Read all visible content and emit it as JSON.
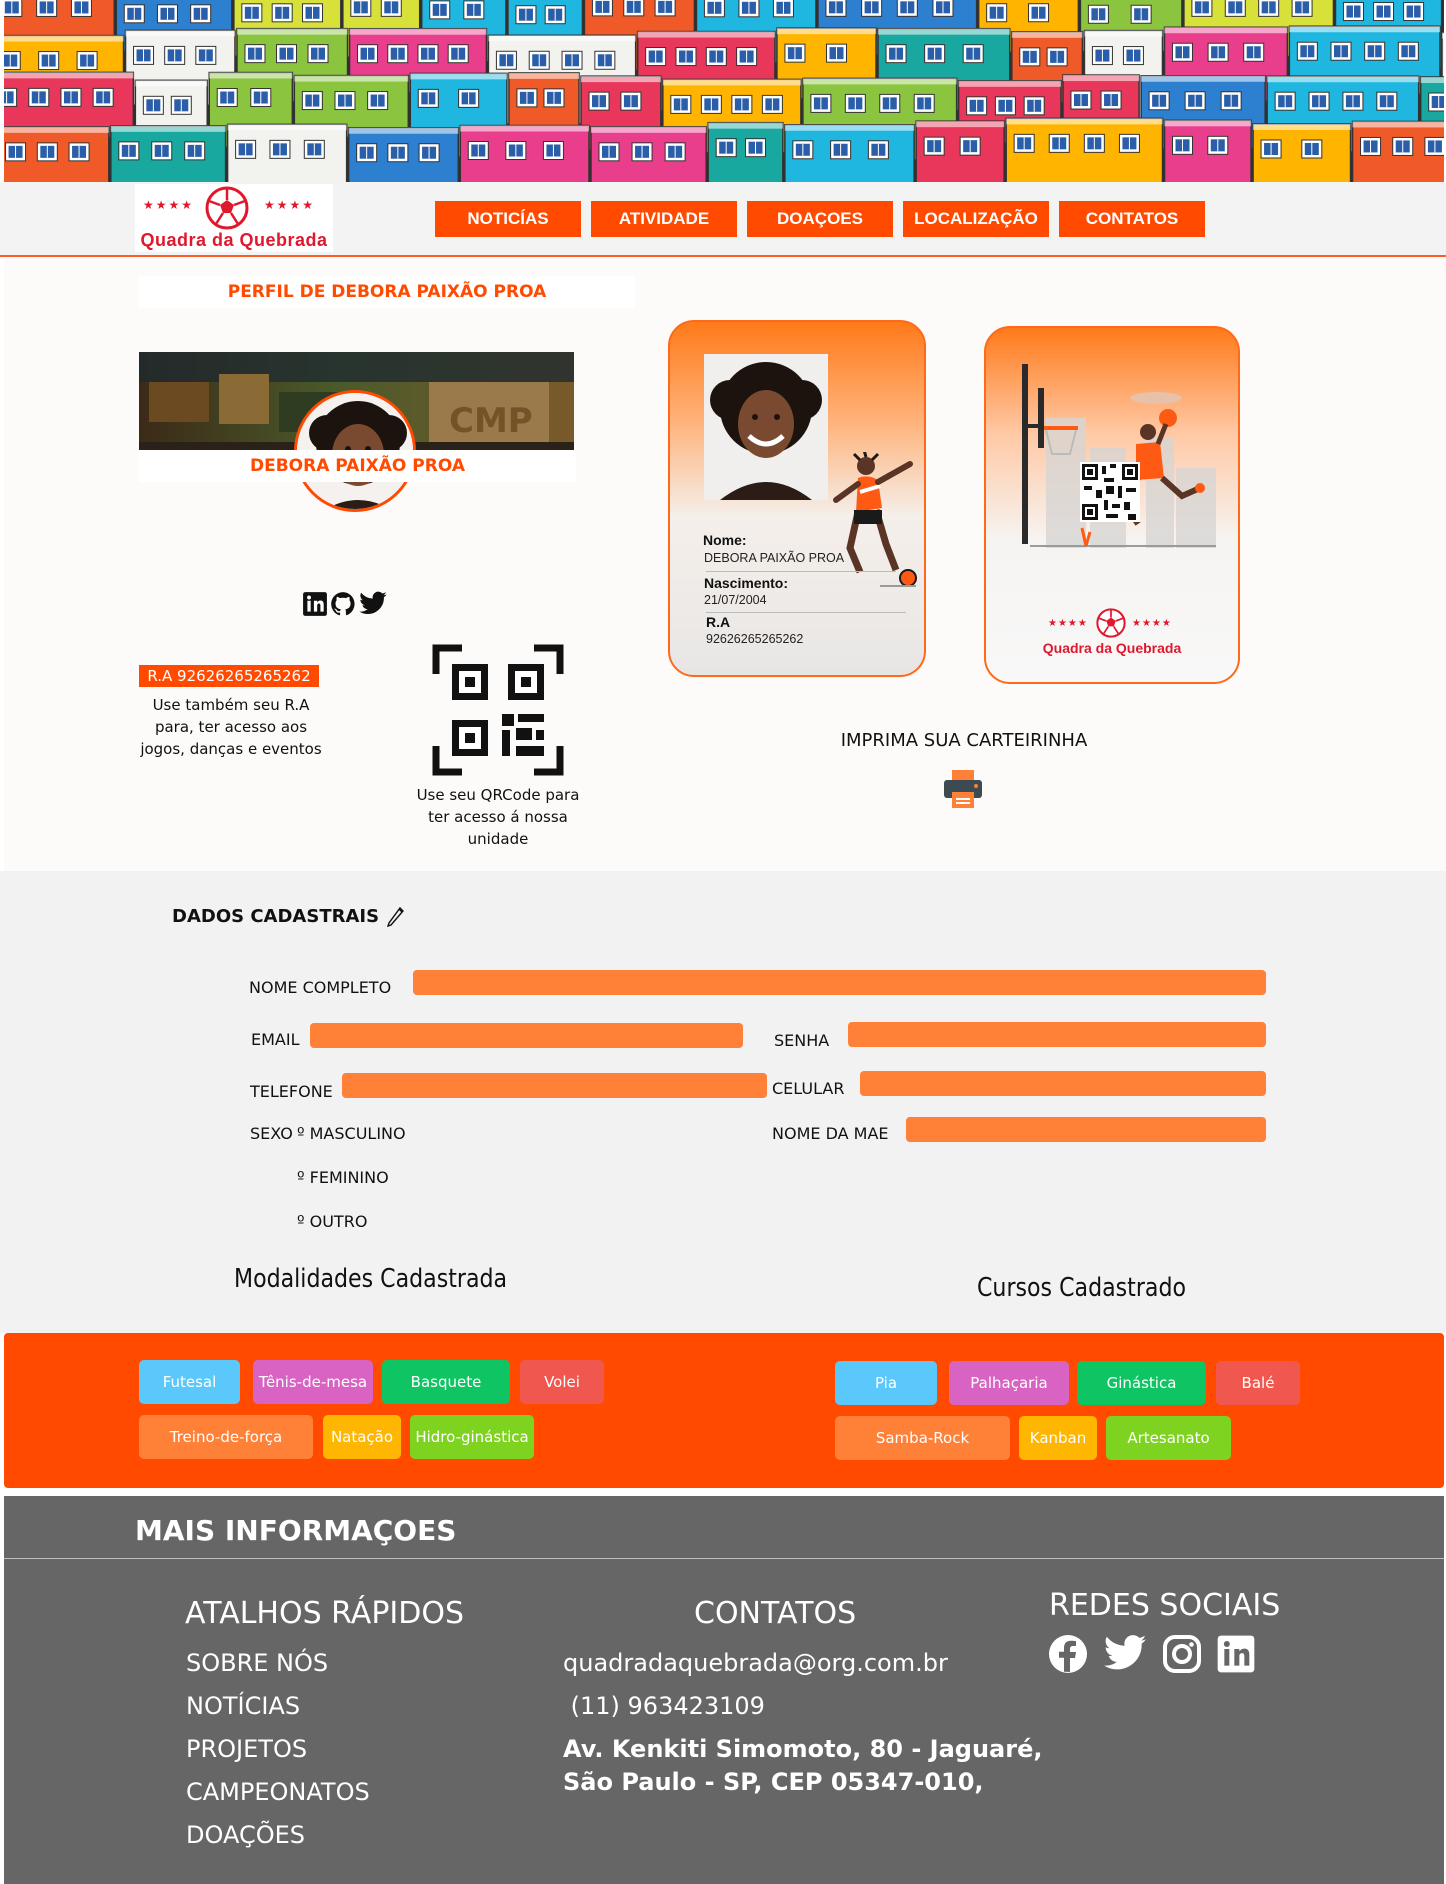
{
  "header": {
    "logo_name": "Quadra da Quebrada",
    "nav": [
      "NOTICÍAS",
      "ATIVIDADE",
      "DOAÇOES",
      "LOCALIZAÇÃO",
      "CONTATOS"
    ]
  },
  "profile": {
    "title": "PERFIL DE DEBORA PAIXÃO PROA",
    "name": "DEBORA PAIXÃO PROA",
    "ra_badge": "R.A 92626265265262",
    "ra_text": "Use também seu R.A para, ter acesso aos jogos, danças e eventos",
    "qr_text": "Use seu QRCode para ter acesso á nossa unidade",
    "print_title": "IMPRIMA SUA CARTEIRINHA",
    "card": {
      "name_label": "Nome:",
      "name_value": "DEBORA PAIXÃO PROA",
      "birth_label": "Nascimento:",
      "birth_value": "21/07/2004",
      "ra_label": "R.A",
      "ra_value": "92626265265262"
    },
    "card_back_logo": "Quadra da Quebrada"
  },
  "registration": {
    "title": "DADOS CADASTRAIS",
    "labels": {
      "nome": "NOME COMPLETO",
      "email": "EMAIL",
      "senha": "SENHA",
      "telefone": "TELEFONE",
      "celular": "CELULAR",
      "sexo": "SEXO",
      "mae": "NOME DA MAE"
    },
    "sexo_options": [
      "º MASCULINO",
      "º FEMININO",
      "º OUTRO"
    ]
  },
  "modalidades": {
    "title": "Modalidades Cadastrada",
    "items": [
      "Futesal",
      "Tênis-de-mesa",
      "Basquete",
      "Volei",
      "Treino-de-força",
      "Natação",
      "Hidro-ginástica"
    ]
  },
  "cursos": {
    "title": "Cursos Cadastrado",
    "items": [
      "Pia",
      "Palhaçaria",
      "Ginástica",
      "Balé",
      "Samba-Rock",
      "Kanban",
      "Artesanato"
    ]
  },
  "tag_colors": {
    "blue": "#5ac8fa",
    "pink": "#d863c2",
    "green": "#0fc462",
    "red": "#f0584f",
    "orange": "#ff8138",
    "yellow": "#ffb600",
    "lime": "#7ed321"
  },
  "footer": {
    "mais": "MAIS INFORMAÇOES",
    "atalhos_title": "ATALHOS RÁPIDOS",
    "atalhos": [
      "SOBRE NÓS",
      "NOTÍCIAS",
      "PROJETOS",
      "CAMPEONATOS",
      "DOAÇÕES"
    ],
    "contatos_title": "CONTATOS",
    "email": "quadradaquebrada@org.com.br",
    "phone": " (11) 963423109",
    "address_1": "Av. Kenkiti Simomoto, 80 - Jaguaré,",
    "address_2": "São Paulo - SP, CEP 05347-010,",
    "redes_title": "REDES SOCIAIS",
    "social_icons": [
      "facebook-icon",
      "twitter-icon",
      "instagram-icon",
      "linkedin-icon"
    ]
  },
  "colors": {
    "accent": "#ff4a00",
    "field": "#ff8138",
    "footer": "#666666",
    "logo_red": "#e0182d"
  }
}
